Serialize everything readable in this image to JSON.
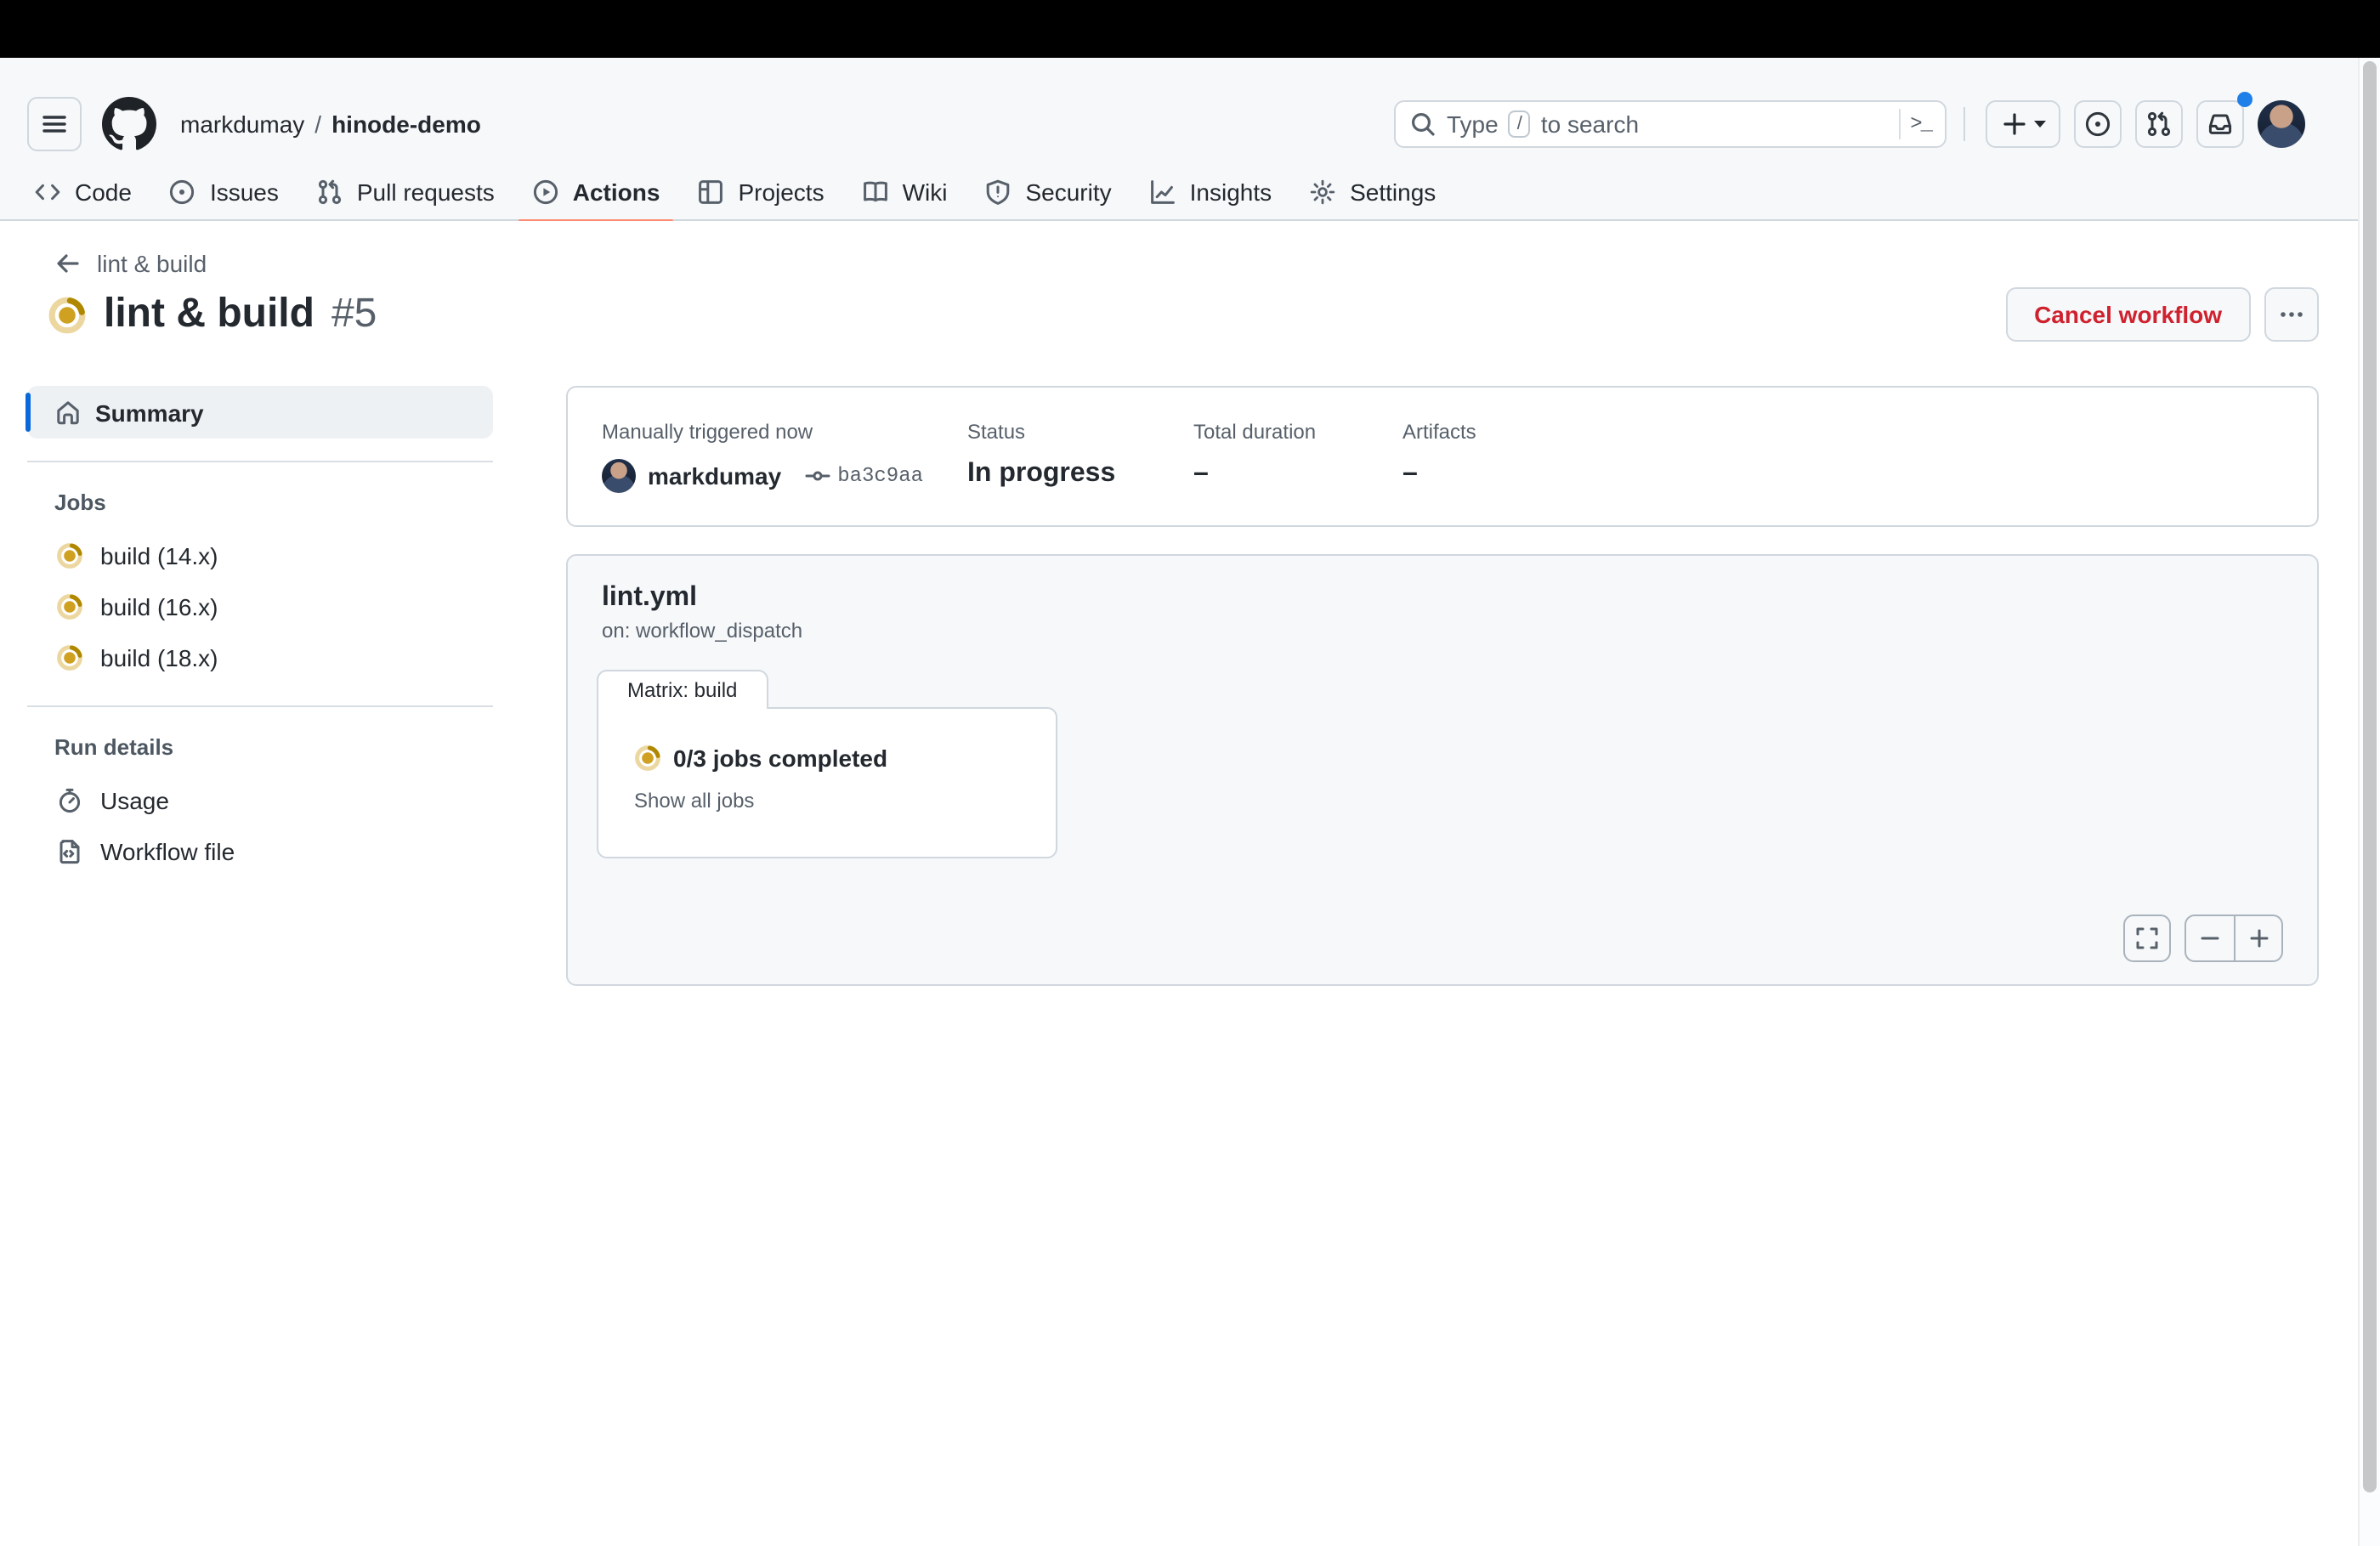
{
  "header": {
    "breadcrumb": {
      "owner": "markdumay",
      "separator": "/",
      "repo": "hinode-demo"
    },
    "search": {
      "prefix": "Type",
      "key": "/",
      "suffix": "to search"
    }
  },
  "nav": {
    "tabs": [
      {
        "label": "Code",
        "active": false
      },
      {
        "label": "Issues",
        "active": false
      },
      {
        "label": "Pull requests",
        "active": false
      },
      {
        "label": "Actions",
        "active": true
      },
      {
        "label": "Projects",
        "active": false
      },
      {
        "label": "Wiki",
        "active": false
      },
      {
        "label": "Security",
        "active": false
      },
      {
        "label": "Insights",
        "active": false
      },
      {
        "label": "Settings",
        "active": false
      }
    ]
  },
  "run": {
    "back_label": "lint & build",
    "title": "lint & build",
    "number": "#5",
    "status": "in_progress",
    "cancel_label": "Cancel workflow"
  },
  "sidebar": {
    "summary_label": "Summary",
    "jobs_title": "Jobs",
    "jobs": [
      {
        "label": "build (14.x)",
        "status": "in_progress"
      },
      {
        "label": "build (16.x)",
        "status": "in_progress"
      },
      {
        "label": "build (18.x)",
        "status": "in_progress"
      }
    ],
    "run_details_title": "Run details",
    "usage_label": "Usage",
    "workflow_file_label": "Workflow file"
  },
  "summary_card": {
    "trigger_label": "Manually triggered now",
    "actor": "markdumay",
    "commit": "ba3c9aa",
    "status_label": "Status",
    "status_value": "In progress",
    "duration_label": "Total duration",
    "duration_value": "–",
    "artifacts_label": "Artifacts",
    "artifacts_value": "–"
  },
  "workflow_card": {
    "file": "lint.yml",
    "trigger": "on: workflow_dispatch",
    "matrix_tab_label": "Matrix: build",
    "progress": "0/3 jobs completed",
    "show_all": "Show all jobs"
  },
  "icons": {
    "status": "in-progress-donut-icon (yellow)",
    "header": [
      "hamburger-icon",
      "github-logo",
      "search-icon",
      "command-palette-icon",
      "plus-icon",
      "caret-down-icon",
      "issue-opened-icon",
      "git-pull-request-icon",
      "inbox-icon"
    ],
    "tabs": [
      "code-icon",
      "issue-opened-icon",
      "git-pull-request-icon",
      "play-circle-icon",
      "project-table-icon",
      "book-icon",
      "shield-icon",
      "graph-icon",
      "gear-icon"
    ],
    "sidebar": [
      "home-icon",
      "stopwatch-icon",
      "code-file-icon"
    ],
    "controls": [
      "fullscreen-icon",
      "minus-icon",
      "plus-icon",
      "kebab-icon",
      "commit-icon",
      "arrow-left-icon"
    ]
  },
  "colors": {
    "header_bg": "#f6f8fa",
    "border": "#d0d7de",
    "text_primary": "#24292f",
    "text_secondary": "#57606a",
    "accent_blue": "#0969da",
    "notification_blue": "#1f7fe8",
    "tab_underline": "#fd8c73",
    "danger_red": "#cf222e",
    "status_yellow": "#d4a72c",
    "status_yellow_dark": "#b08800"
  }
}
